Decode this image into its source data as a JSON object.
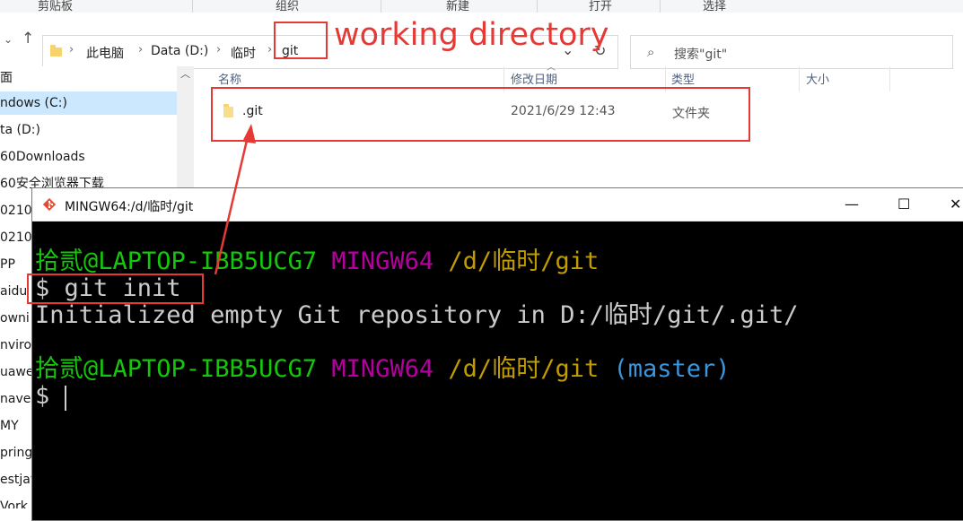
{
  "ribbon": {
    "groups": [
      "剪贴板",
      "组织",
      "新建",
      "打开",
      "选择"
    ]
  },
  "nav": {
    "back_icon": "chevron-down-icon",
    "up_icon": "arrow-up-icon",
    "breadcrumb": [
      "此电脑",
      "Data (D:)",
      "临时",
      "git"
    ],
    "search_placeholder": "搜索\"git\""
  },
  "sidebar": {
    "items": [
      {
        "label": "面"
      },
      {
        "label": "ndows (C:)",
        "selected": true
      },
      {
        "label": "ta (D:)"
      },
      {
        "label": "60Downloads"
      },
      {
        "label": "60安全浏览器下载"
      },
      {
        "label": "0210"
      },
      {
        "label": "0210"
      },
      {
        "label": "PP"
      },
      {
        "label": "aidu"
      },
      {
        "label": "owni"
      },
      {
        "label": "nviro"
      },
      {
        "label": "uawe"
      },
      {
        "label": "naven"
      },
      {
        "label": "MY"
      },
      {
        "label": "pring"
      },
      {
        "label": "estjav"
      },
      {
        "label": "Vork"
      }
    ]
  },
  "filelist": {
    "columns": {
      "name": "名称",
      "modified": "修改日期",
      "type": "类型",
      "size": "大小"
    },
    "rows": [
      {
        "name": ".git",
        "modified": "2021/6/29 12:43",
        "type": "文件夹",
        "size": ""
      }
    ]
  },
  "annotations": {
    "working_directory": "working directory",
    "color": "#e53935"
  },
  "terminal": {
    "title": "MINGW64:/d/临时/git",
    "controls": {
      "minimize": "—",
      "maximize": "☐",
      "close": "✕"
    },
    "prompt1": {
      "user": "拾贰@LAPTOP-IBB5UCG7",
      "env": "MINGW64",
      "path": "/d/临时/git"
    },
    "command": "$ git init",
    "output": "Initialized empty Git repository in D:/临时/git/.git/",
    "prompt2": {
      "user": "拾贰@LAPTOP-IBB5UCG7",
      "env": "MINGW64",
      "path": "/d/临时/git",
      "branch": "(master)"
    },
    "input_prompt": "$",
    "colors": {
      "user": "#16c60c",
      "env": "#b4009e",
      "path": "#c19c00",
      "branch": "#3a96dd",
      "text": "#cccccc",
      "bg": "#000000"
    }
  }
}
